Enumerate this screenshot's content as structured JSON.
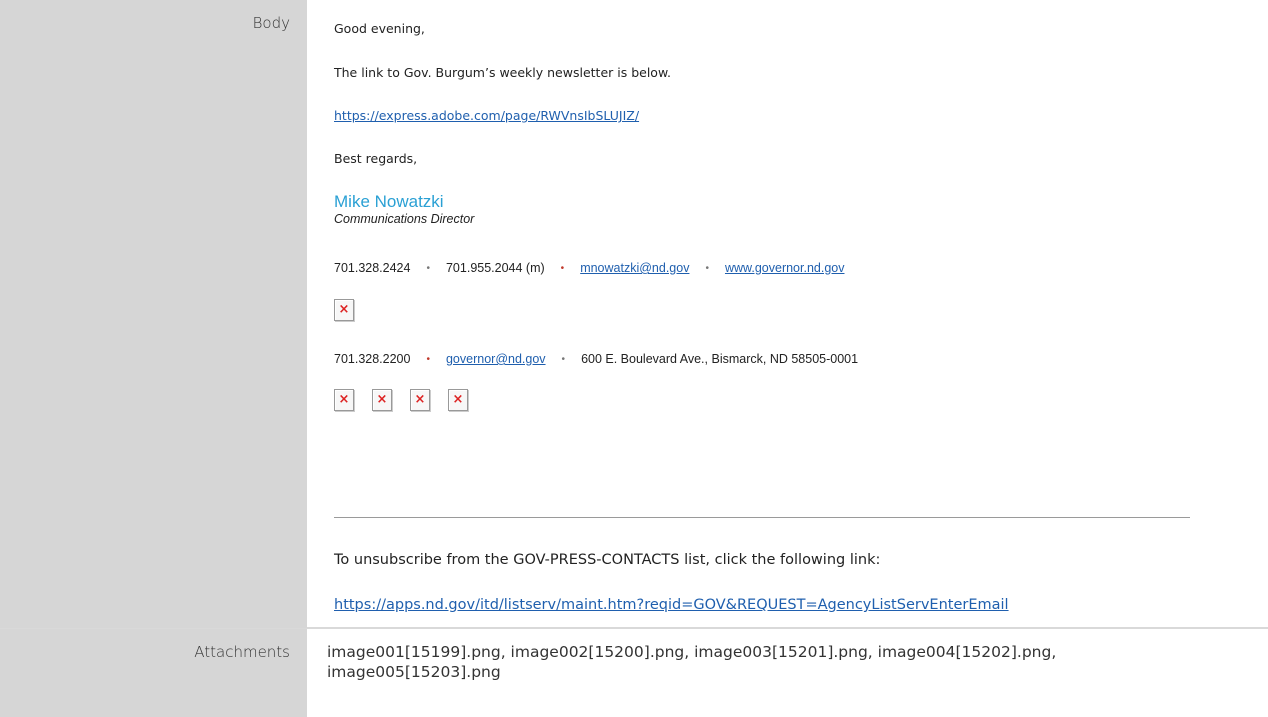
{
  "rows": {
    "body_label": "Body",
    "attachments_label": "Attachments",
    "attachments_value": "image001[15199].png, image002[15200].png, image003[15201].png, image004[15202].png, image005[15203].png"
  },
  "email": {
    "greeting": "Good evening,",
    "intro": "The link to Gov. Burgum’s weekly newsletter is below.",
    "newsletter_link": "https://express.adobe.com/page/RWVnsIbSLUJIZ/",
    "closing": "Best regards,",
    "sig_name": "Mike Nowatzki",
    "sig_title": "Communications Director",
    "contact1": {
      "phone": "701.328.2424",
      "mobile": "701.955.2044 (m)",
      "email": "mnowatzki@nd.gov",
      "website": "www.governor.nd.gov",
      "separator": "•"
    },
    "contact2": {
      "phone": "701.328.2200",
      "email": "governor@nd.gov",
      "address": "600 E. Boulevard Ave., Bismarck, ND  58505-0001",
      "separator": "•"
    },
    "broken_image_glyph": "×",
    "unsubscribe_text": "To unsubscribe from the GOV-PRESS-CONTACTS list, click the following link:",
    "unsubscribe_link": "https://apps.nd.gov/itd/listserv/maint.htm?reqid=GOV&REQUEST=AgencyListServEnterEmail"
  }
}
